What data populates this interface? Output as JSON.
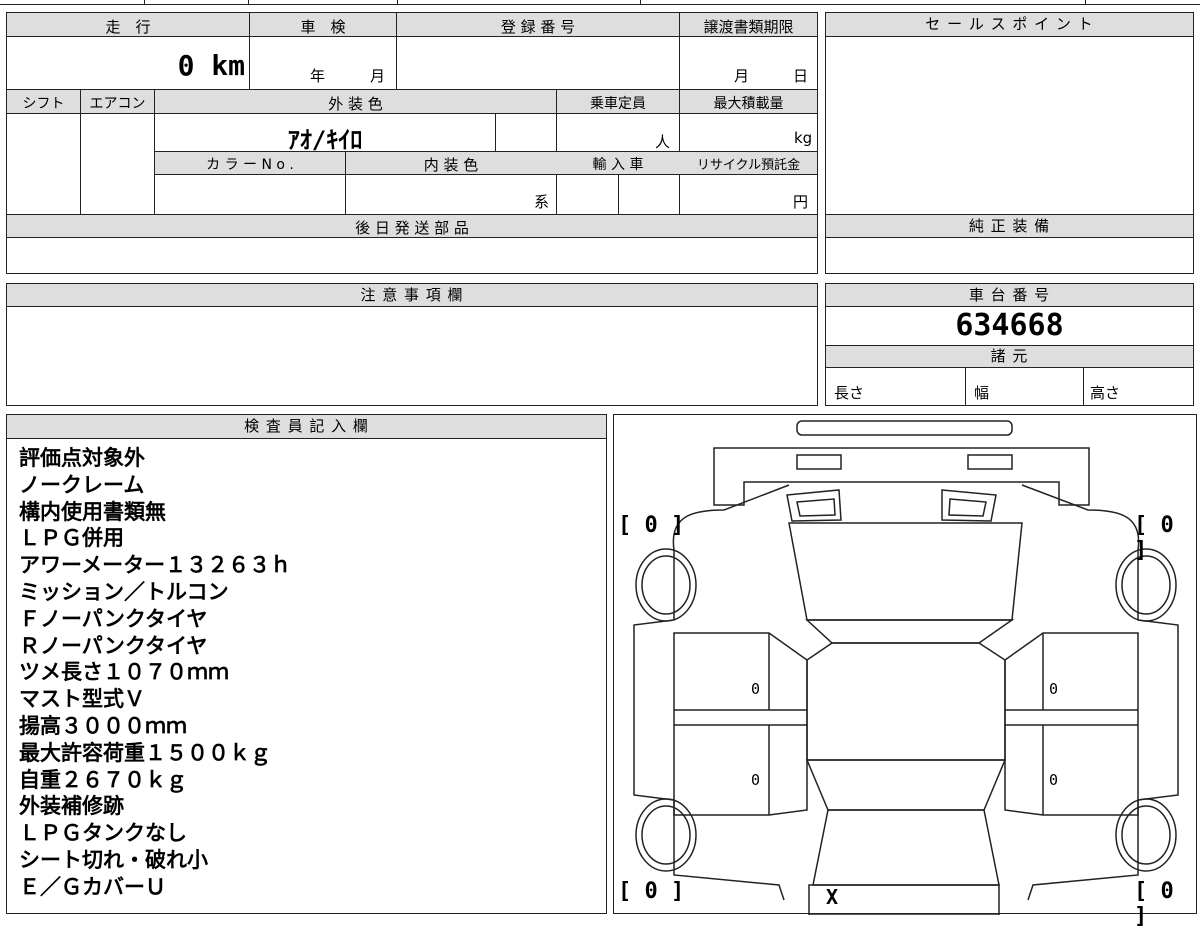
{
  "main_form": {
    "headers": {
      "mileage": "走　行",
      "inspection": "車　検",
      "registration": "登 録 番 号",
      "transfer_deadline": "譲渡書類期限",
      "shift": "シフト",
      "aircon": "エアコン",
      "exterior_color": "外 装 色",
      "capacity": "乗車定員",
      "max_load": "最大積載量",
      "color_no": "カ ラ ー N o .",
      "interior_color": "内 装 色",
      "import": "輸 入 車",
      "recycle": "リサイクル預託金",
      "later_parts": "後 日 発 送 部 品"
    },
    "values": {
      "mileage": "0 km",
      "year_unit": "年",
      "month_unit": "月",
      "deadline_month": "月",
      "deadline_day": "日",
      "exterior_color": "ｱｵ/ｷｲﾛ",
      "capacity_unit": "人",
      "load_unit": "kg",
      "interior_unit": "系",
      "recycle_unit": "円"
    }
  },
  "sales_point": {
    "header": "セ ー ル ス ポ イ ン ト"
  },
  "genuine_equipment": {
    "header": "純 正 装 備"
  },
  "notes_section": {
    "header": "注 意 事 項 欄"
  },
  "chassis": {
    "header": "車 台 番 号",
    "number": "634668"
  },
  "specs": {
    "header": "諸 元",
    "length": "長さ",
    "width": "幅",
    "height": "高さ"
  },
  "inspector": {
    "header": "検 査 員 記 入 欄",
    "lines": [
      "評価点対象外",
      "ノークレーム",
      "構内使用書類無",
      "ＬＰＧ併用",
      "アワーメーター１３２６３ｈ",
      "ミッション／トルコン",
      "Ｆノーパンクタイヤ",
      "Ｒノーパンクタイヤ",
      "ツメ長さ１０７０ｍｍ",
      "マスト型式Ｖ",
      "揚高３０００ｍｍ",
      "最大許容荷重１５００ｋｇ",
      "自重２６７０ｋｇ",
      "外装補修跡",
      "ＬＰＧタンクなし",
      "シート切れ・破れ小",
      "Ｅ／ＧカバーＵ"
    ]
  },
  "diagram": {
    "tire_top_left": "[ 0 ]",
    "tire_top_right": "[ 0 ]",
    "tire_bottom_left": "[ 0 ]",
    "tire_bottom_right": "[ 0 ]",
    "door_fl": "0",
    "door_rl": "0",
    "door_fr": "0",
    "door_rr": "0",
    "rear_mark": "X"
  }
}
